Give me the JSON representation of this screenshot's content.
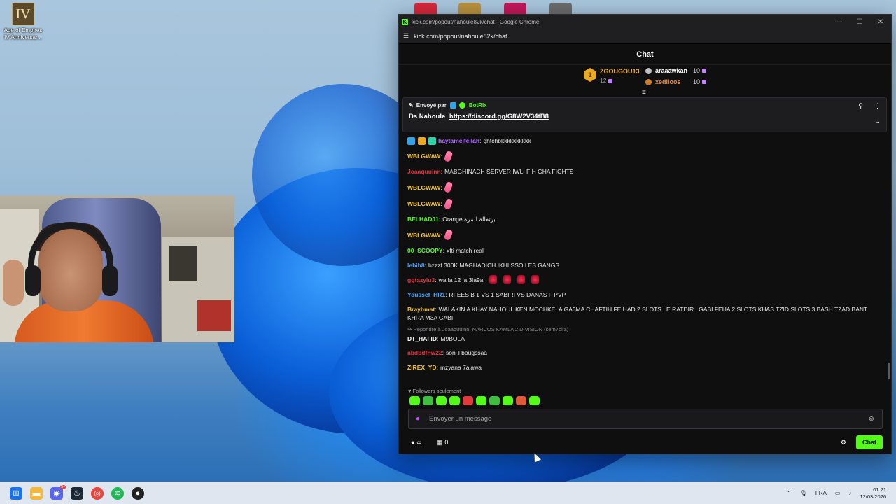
{
  "desktop": {
    "icon_label": "Age of Empires IV Anniversar...",
    "icon_glyph": "IV"
  },
  "window": {
    "title": "kick.com/popout/nahoule82k/chat - Google Chrome",
    "url": "kick.com/popout/nahoule82k/chat",
    "controls": {
      "minimize": "—",
      "maximize": "☐",
      "close": "✕"
    }
  },
  "chat": {
    "header": "Chat",
    "leaderboard": {
      "first": {
        "rank": "1",
        "name": "ZGOUGOU13",
        "count": "12"
      },
      "others": [
        {
          "name": "araaawkan",
          "count": "10",
          "color": "#ffffff",
          "medal": "#c0c0c0"
        },
        {
          "name": "xediloos",
          "count": "10",
          "color": "#e88a3a",
          "medal": "#cd7f32"
        }
      ]
    },
    "pinned": {
      "sent_by": "Envoyé par",
      "author": "BotRix",
      "text": "Ds Nahoule",
      "link": "https://discord.gg/G8W2V34tB8"
    },
    "messages": [
      {
        "user": "haytamelfellah",
        "color": "#b36cff",
        "text": "ghtchbkkkkkkkkkk"
      },
      {
        "user": "WBLGWAW",
        "color": "#f2c230",
        "text": ""
      },
      {
        "user": "Joaaquuinn",
        "color": "#e8313f",
        "text": "MABGHINACH SERVER IWLI FIH GHA FIGHTS"
      },
      {
        "user": "WBLGWAW",
        "color": "#f2c230",
        "text": ""
      },
      {
        "user": "WBLGWAW",
        "color": "#f2c230",
        "text": ""
      },
      {
        "user": "BELHADJ1",
        "color": "#53fc18",
        "text": "Orange برتقالة المرة"
      },
      {
        "user": "WBLGWAW",
        "color": "#f2c230",
        "text": ""
      },
      {
        "user": "00_SCOOPY",
        "color": "#53fc18",
        "text": "xfti match real"
      },
      {
        "user": "lebih8",
        "color": "#4aa3ff",
        "text": "bzzzf 300K MAGHADICH IKHLSSO LES GANGS"
      },
      {
        "user": "ggtazyiu3",
        "color": "#e8313f",
        "text": "wa la 12 la 3la9a"
      },
      {
        "user": "Youssef_HR1",
        "color": "#4aa3ff",
        "text": "RFEES B 1 VS 1 SABIRI VS DANAS F PVP"
      },
      {
        "user": "Brayhmat",
        "color": "#f2c230",
        "text": "WALAKIN A KHAY NAHOUL KEN MOCHKELA GA3MA CHAFTIH FE HAD 2 SLOTS LE RATDIR , GABI FEHA 2 SLOTS KHAS TZID SLOTS 3 BASH TZAD BANT KHRA M3A GABI"
      },
      {
        "user": "DT_HAFID",
        "color": "#ffffff",
        "text": "M9BOLA"
      },
      {
        "user": "abdbdfhw22",
        "color": "#e8313f",
        "text": "soni l bougssaa"
      },
      {
        "user": "ZIREX_YD",
        "color": "#f2c230",
        "text": "mzyana 7alawa"
      }
    ],
    "reply_note": "Répondre à Joaaquuinn: NARCOS KAMLA 2 DIVISION (sem7olia)",
    "followers_only": "Followers seulement",
    "composer": {
      "placeholder": "Envoyer un message"
    },
    "bottom": {
      "infinity": "∞",
      "store_count": "0",
      "send_label": "Chat"
    }
  },
  "taskbar": {
    "language": "FRA",
    "time": "01:21",
    "date": "12/03/2026",
    "discord_badge": "9+"
  }
}
